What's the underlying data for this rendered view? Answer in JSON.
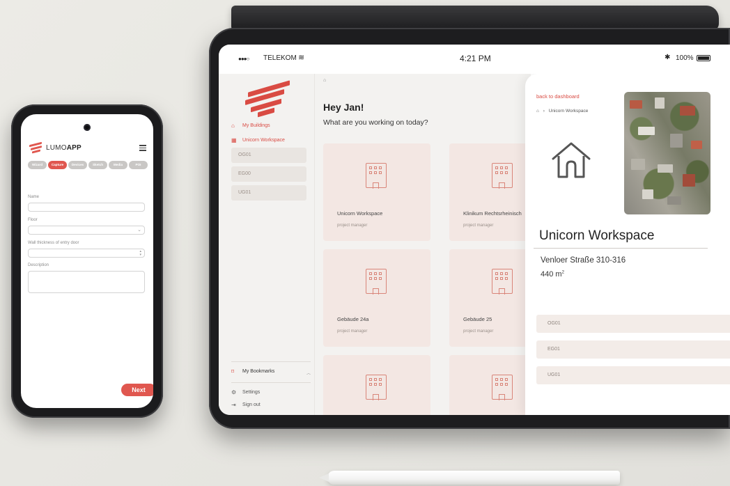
{
  "phone": {
    "app_name_light": "LUMO",
    "app_name_bold": "APP",
    "tabs": [
      {
        "label": "Wizard",
        "active": false
      },
      {
        "label": "Capture",
        "active": true
      },
      {
        "label": "Devices",
        "active": false
      },
      {
        "label": "Sketch",
        "active": false
      },
      {
        "label": "Media",
        "active": false
      },
      {
        "label": "POI",
        "active": false
      }
    ],
    "form": {
      "name_label": "Name",
      "name_value": "",
      "floor_label": "Floor",
      "floor_value": "",
      "wall_label": "Wall thickness of entry door",
      "wall_value": "",
      "description_label": "Description",
      "description_value": ""
    },
    "next_label": "Next"
  },
  "tablet": {
    "status": {
      "carrier": "TELEKOM",
      "time": "4:21 PM",
      "battery": "100%"
    },
    "sidebar": {
      "my_buildings": "My Buildings",
      "current_building": "Unicorn Workspace",
      "floors": [
        "OG01",
        "EG00",
        "UG01"
      ],
      "bookmarks": "My Bookmarks",
      "settings": "Settings",
      "sign_out": "Sign out"
    },
    "main": {
      "greeting": "Hey Jan!",
      "question": "What are you working on today?",
      "cards": [
        {
          "title": "Unicorn Workspace",
          "role": "project manager"
        },
        {
          "title": "Klinikum Rechtsrheinisch",
          "role": "project manager"
        },
        {
          "title": "Gebäude 24a",
          "role": "project manager"
        },
        {
          "title": "Gebäude 25",
          "role": "project manager"
        },
        {
          "title": "",
          "role": ""
        },
        {
          "title": "",
          "role": ""
        }
      ]
    },
    "detail": {
      "back_link": "back to dashboard",
      "breadcrumb": "Unicorn Workspace",
      "title": "Unicorn Workspace",
      "address": "Venloer Straße 310-316",
      "area_value": "440 m",
      "area_unit_sup": "2",
      "floors": [
        "OG01",
        "EG01",
        "UG01"
      ]
    }
  },
  "colors": {
    "accent": "#e0574f",
    "card_bg": "#f3e7e3",
    "sidebar_bg": "#f3f2f0"
  }
}
